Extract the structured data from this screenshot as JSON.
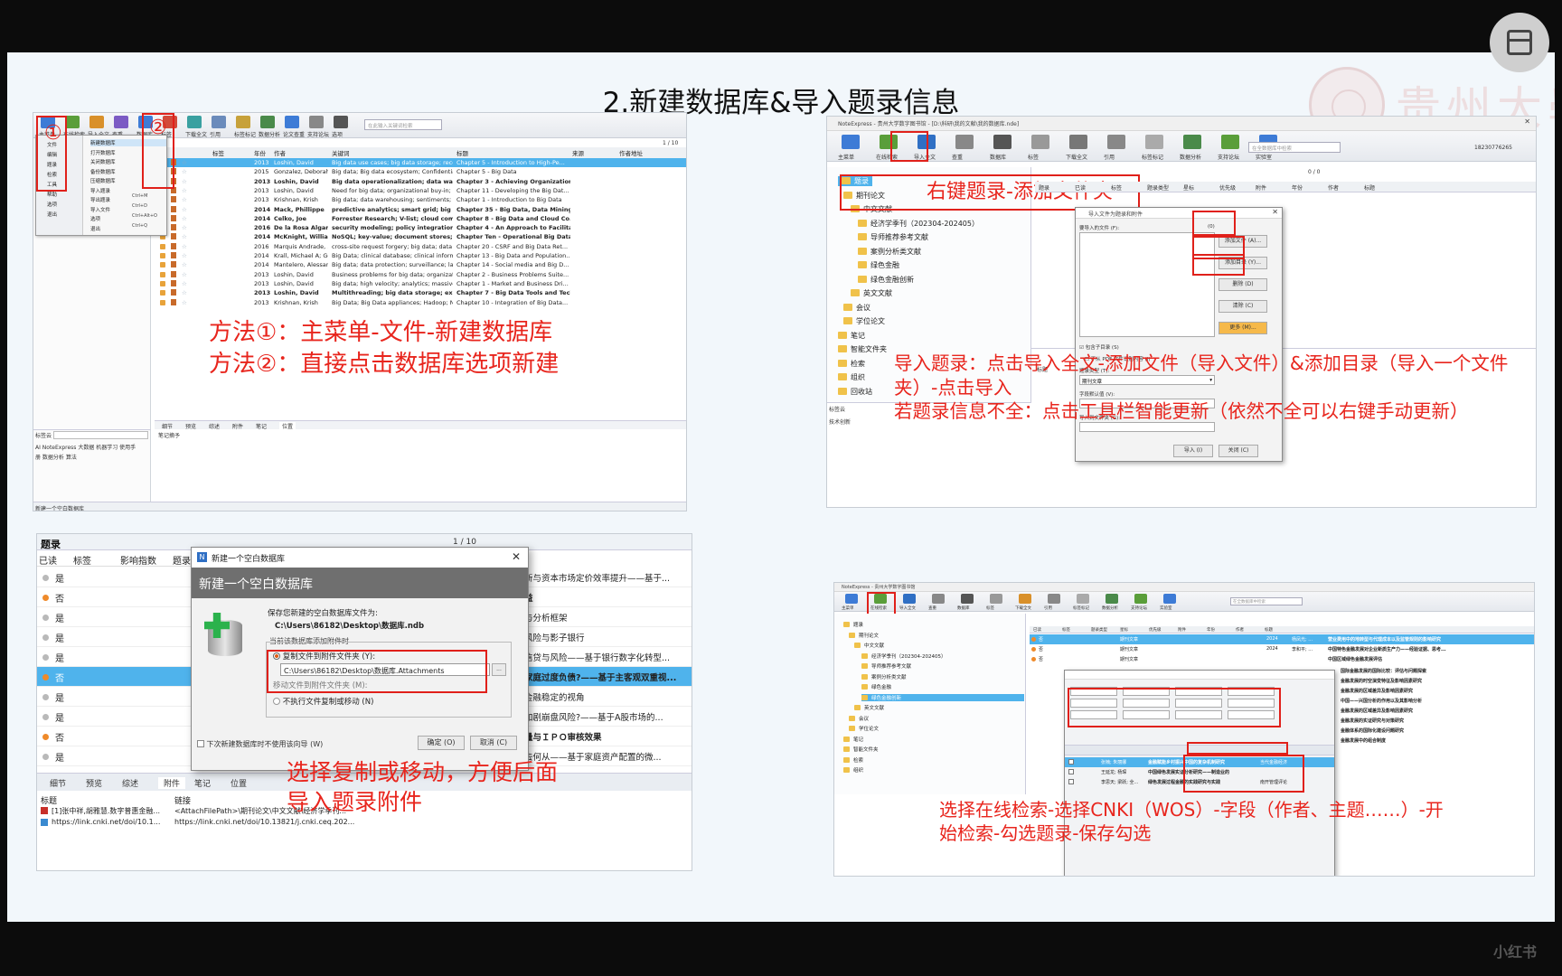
{
  "slide": {
    "title": "2.新建数据库&导入题录信息",
    "logo_text": "贵州大學"
  },
  "viewer": {
    "watermark": "小红书",
    "layout_icon": "layout-icon"
  },
  "q1": {
    "annot_num1": "①",
    "annot_num2": "②",
    "annot_text": "方法①：主菜单-文件-新建数据库\n方法②：直接点击数据库选项新建",
    "toolbar": [
      "主菜单",
      "在线检索",
      "导入全文",
      "查重",
      "数据库",
      "标签",
      "下载全文",
      "引用",
      "标签标记",
      "数据分析",
      "论文查重",
      "支持论坛",
      "选项"
    ],
    "search_placeholder": "在此输入关键词检索",
    "pager": "1 / 10",
    "columns": [
      "标签",
      "年份",
      "作者",
      "关键词",
      "标题",
      "来源",
      "作者地址"
    ],
    "menu": [
      "新建数据库",
      "打开数据库",
      "关闭数据库",
      "备份数据库",
      "压缩数据库",
      "导入题录",
      "导出题录",
      "导入文件",
      "选项",
      "退出"
    ],
    "menu_left": [
      "文件",
      "编辑",
      "题录",
      "检索",
      "工具",
      "帮助",
      "选项",
      "退出"
    ],
    "shortcuts": [
      "Ctrl+M",
      "Ctrl+D",
      "Ctrl+Alt+O",
      "Ctrl+Q"
    ],
    "rows": [
      {
        "year": "2013",
        "author": "Loshin, David",
        "kw": "Big data use cases; big data storage; recommendation engi...",
        "title": "Chapter 5 - Introduction to High-Pe..."
      },
      {
        "year": "2015",
        "author": "Gonzalez, Deborah",
        "kw": "Big data; Big data ecosystem; Confidentiality; Data access; ...",
        "title": "Chapter 5 - Big Data"
      },
      {
        "year": "2013",
        "author": "Loshin, David",
        "kw": "Big data operationalization; data warehouse; culture ch",
        "title": "Chapter 3 - Achieving Organization"
      },
      {
        "year": "2013",
        "author": "Loshin, David",
        "kw": "Need for big data; organizational buy-in; team building; bi...",
        "title": "Chapter 11 - Developing the Big Dat..."
      },
      {
        "year": "2013",
        "author": "Krishnan, Krish",
        "kw": "Big data; data warehousing; sentiments; social media; mac...",
        "title": "Chapter 1 - Introduction to Big Data"
      },
      {
        "year": "2014",
        "author": "Mack, Phillippe",
        "kw": "predictive analytics; smart grid; big data; high perform",
        "title": "Chapter 35 - Big Data, Data Mining,"
      },
      {
        "year": "2014",
        "author": "Celko, Joe",
        "kw": "Forrester Research; V-list; cloud computing; Big Data; d",
        "title": "Chapter 8 - Big Data and Cloud Co..."
      },
      {
        "year": "2016",
        "author": "De la Rosa Algarin, A",
        "kw": "security modeling; policy integration; big-data applicat",
        "title": "Chapter 4 - An Approach to Facilita"
      },
      {
        "year": "2014",
        "author": "McKnight, William",
        "kw": "NoSQL; key-value; document stores; column stores; big",
        "title": "Chapter Ten - Operational Big Data"
      },
      {
        "year": "2016",
        "author": "Marquis Andrade, ...",
        "kw": "cross-site request forgery; big data; data integrity",
        "title": "Chapter 20 - CSRF and Big Data Ret..."
      },
      {
        "year": "2014",
        "author": "Krall, Michael A; Gon...",
        "kw": "Big Data; clinical database; clinical informatics; data analyt...",
        "title": "Chapter 13 - Big Data and Population..."
      },
      {
        "year": "2014",
        "author": "Mantelero, Alessand...",
        "kw": "Big data; data protection; surveillance; law and enforceme...",
        "title": "Chapter 14 - Social media and Big D..."
      },
      {
        "year": "2013",
        "author": "Loshin, David",
        "kw": "Business problems for big data; organizational fitness; big ...",
        "title": "Chapter 2 - Business Problems Suite..."
      },
      {
        "year": "2013",
        "author": "Loshin, David",
        "kw": "Big data; high velocity; analytics; massive data volume; big ...",
        "title": "Chapter 1 - Market and Business Dri..."
      },
      {
        "year": "2013",
        "author": "Loshin, David",
        "kw": "Multithreading; big data storage; execution manageme",
        "title": "Chapter 7 - Big Data Tools and Tech"
      },
      {
        "year": "2013",
        "author": "Krishnan, Krish",
        "kw": "Big Data; Big Data appliances; Hadoop; NoSQL; RDBMS; d...",
        "title": "Chapter 10 - Integration of Big Data..."
      }
    ],
    "bottom_tabs": [
      "细节",
      "预览",
      "综述",
      "附件",
      "笔记",
      "位置"
    ],
    "bottom_note": "笔记摘予",
    "tags_label": "标签云",
    "tags_row1": "AI  NoteExpress  大数据  机器学习  使用手",
    "tags_row2": "册  数据分析  算法",
    "status": "新建一个空白数据库"
  },
  "q2": {
    "window_title": "NoteExpress - 贵州大学数字图书馆 - [D:\\科研\\我的文献\\我的数据库.nde]",
    "toolbar": [
      "主菜单",
      "在线检索",
      "导入全文",
      "查重",
      "数据库",
      "标签",
      "下载全文",
      "引用",
      "标签标记",
      "数据分析",
      "支持论坛",
      "实验室"
    ],
    "search_placeholder": "在全数据库中检索",
    "user": "18230776265",
    "tree": [
      "题录",
      "期刊论文",
      "中文文献",
      "经济学季刊（202304-202405）",
      "导师推荐参考文献",
      "案例分析类文献",
      "绿色金融",
      "绿色金融创新",
      "英文文献",
      "会议",
      "学位论文",
      "笔记",
      "智能文件夹",
      "检索",
      "组织",
      "回收站"
    ],
    "tags_label": "标签云",
    "tag1": "技术创新",
    "grid_header": [
      "题录",
      "已读",
      "标签",
      "题录类型",
      "星标",
      "优先级",
      "附件",
      "年份",
      "作者",
      "标题"
    ],
    "pager": "0 / 0",
    "dialog_title": "导入文件为题录和附件",
    "dialog_files_label": "要导入的文件 (F):",
    "dialog_files_count": "(0)",
    "dialog_buttons": [
      "添加文件 (A)...",
      "添加目录 (Y)...",
      "删除 (D)",
      "清除 (C)",
      "更多 (M)..."
    ],
    "dialog_check1": "包含子目录 (S)",
    "dialog_check2": "不从 PDF 文件识别内容 (I)",
    "dialog_type_label": "题录类型 (T):",
    "dialog_type_value": "期刊文章",
    "dialog_field_label": "字段默认值 (V):",
    "dialog_target_label": "导入到文件夹 (G):",
    "dialog_ok": "导入 (I)",
    "dialog_close": "关闭 (C)",
    "detail_tabs": [
      "细节",
      "预览",
      "综述",
      "附件",
      "笔记",
      "位置"
    ],
    "detail_field": "标题",
    "annot_top": "右键题录-添加文件夹",
    "annot_bottom": "导入题录：点击导入全文-添加文件（导入文件）&添加目录（导入一个文件夹）-点击导入\n若题录信息不全：点击工具栏智能更新（依然不全可以右键手动更新）"
  },
  "q3": {
    "header_title": "题录",
    "pager": "1 / 10",
    "columns": [
      "已读",
      "标签",
      "影响指数",
      "题录"
    ],
    "rows": [
      {
        "read": "是",
        "dot": "#b9b9b9"
      },
      {
        "read": "否",
        "dot": "#ef8a2a"
      },
      {
        "read": "是",
        "dot": "#b9b9b9"
      },
      {
        "read": "是",
        "dot": "#b9b9b9"
      },
      {
        "read": "是",
        "dot": "#b9b9b9"
      },
      {
        "read": "否",
        "dot": "#ef8a2a"
      },
      {
        "read": "是",
        "dot": "#b9b9b9"
      },
      {
        "read": "是",
        "dot": "#b9b9b9"
      },
      {
        "read": "否",
        "dot": "#ef8a2a"
      },
      {
        "read": "是",
        "dot": "#b9b9b9"
      }
    ],
    "right_rows": [
      "技创新与资本市场定价效率提升——基于...",
      "票收益",
      "内涵与分析框架",
      "尾部风险与影子银行",
      "小微信贷与风险——基于银行数字化转型...",
      "影响家庭过度负债?——基于主客观双重视...",
      "平：金融稳定的视角",
      "是否加剧崩盘风险?——基于A股市场的...",
      "选质量与ＩＰＯ审核效果",
      "会可去何从——基于家庭资产配置的微..."
    ],
    "bottom_tabs": [
      "细节",
      "预览",
      "综述",
      "附件",
      "笔记",
      "位置"
    ],
    "link_header": [
      "标题",
      "链接"
    ],
    "links": [
      {
        "title": "[1]张中祥,胡雅慧.数字普惠金融...",
        "link": "<AttachFilePath>\\期刊论文\\中文文献\\经济学季刊..."
      },
      {
        "title": "https://link.cnki.net/doi/10.1...",
        "link": "https://link.cnki.net/doi/10.13821/j.cnki.ceq.202..."
      }
    ],
    "dialog_title": "新建一个空白数据库",
    "dialog_heading": "新建一个空白数据库",
    "save_label": "保存您新建的空白数据库文件为:",
    "save_path": "C:\\Users\\86182\\Desktop\\数据库.ndb",
    "group_label": "当前该数据库添加附件时",
    "opt1": "复制文件到附件文件夹 (Y):",
    "path": "C:\\Users\\86182\\Desktop\\数据库.Attachments",
    "browse": "...",
    "opt2": "移动文件到附件文件夹 (M):",
    "opt3": "不执行文件复制或移动 (N)",
    "checkbox": "下次新建数据库时不使用该向导 (W)",
    "ok": "确定 (O)",
    "cancel": "取消 (C)",
    "annot": "选择复制或移动，方便后面\n导入题录附件"
  },
  "q4": {
    "window_title": "NoteExpress - 贵州大学数字图书馆",
    "toolbar": [
      "主菜单",
      "在线检索",
      "导入全文",
      "查重",
      "数据库",
      "标签",
      "下载全文",
      "引用",
      "标签标记",
      "数据分析",
      "支持论坛",
      "实验室"
    ],
    "search_placeholder": "在全数据库中检索",
    "tree": [
      "题录",
      "期刊论文",
      "中文文献",
      "经济学季刊（202304-202405）",
      "导师推荐参考文献",
      "案例分析类文献",
      "绿色金融",
      "绿色金融创新",
      "英文文献",
      "会议",
      "学位论文",
      "笔记",
      "智能文件夹",
      "检索",
      "组织"
    ],
    "grid_header": [
      "已读",
      "标签",
      "题录类型",
      "星标",
      "优先级",
      "附件",
      "年份",
      "作者",
      "标题"
    ],
    "rows": [
      {
        "read": "否",
        "type": "期刊文章",
        "year": "2024",
        "author": "杨凤光; ...",
        "title": "营业费用中的地转型与代理成本以及监管规则的影响研究"
      },
      {
        "read": "否",
        "type": "期刊文章",
        "year": "2024",
        "author": "李和平; ...",
        "title": "中国特色金融发展对企业新质生产力——经验证据、思考..."
      },
      {
        "read": "否",
        "type": "期刊文章",
        "year": "",
        "author": "",
        "title": "中国区域绿色金融发展评估"
      }
    ],
    "right_list": [
      "国际金融发展的国际比较：评估与问题探索",
      "金融发展的时空演变特征及影响因素研究",
      "金融发展的区域差异及影响因素研究",
      "中国——兴国分析的作用以及其影响分析",
      "金融发展的区域差异及影响因素研究",
      "金融发展的实证研究与对策研究",
      "金融体系的国际化建设问题研究",
      "金融发展中的组合制度"
    ],
    "result_rows": [
      {
        "author": "张楠; 朱丽娜",
        "title": "金融赋能乡村振兴中国的复杂机制研究",
        "src": "当代金融经济"
      },
      {
        "author": "王延龙; 杨琛",
        "title": "中国绿色发展实证分析研究——制造业的",
        "src": ""
      },
      {
        "author": "李思天; 梁跃; 全...",
        "title": "绿色发展过程金融的实践研究与实践",
        "src": "南开管理评论"
      }
    ],
    "annot": "选择在线检索-选择CNKI（WOS）-字段（作者、主题……）-开始检索-勾选题录-保存勾选"
  }
}
